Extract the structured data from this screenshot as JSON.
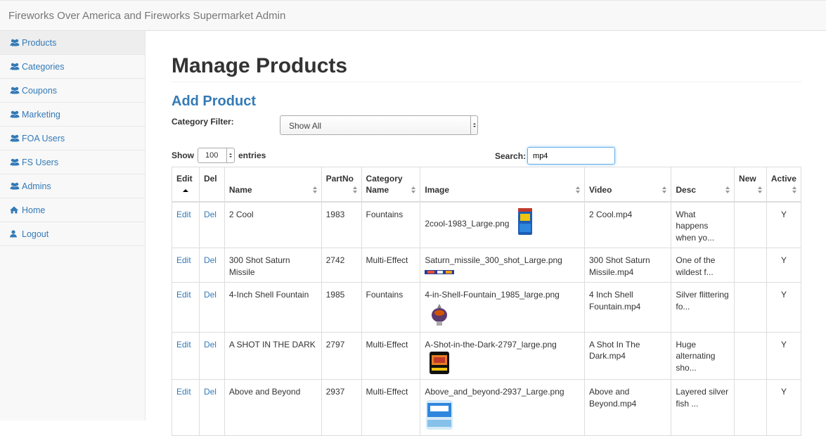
{
  "app": {
    "title": "Fireworks Over America and Fireworks Supermarket Admin"
  },
  "sidebar": {
    "items": [
      {
        "label": "Products",
        "icon": "users-icon",
        "active": true
      },
      {
        "label": "Categories",
        "icon": "users-icon"
      },
      {
        "label": "Coupons",
        "icon": "users-icon"
      },
      {
        "label": "Marketing",
        "icon": "users-icon"
      },
      {
        "label": "FOA Users",
        "icon": "users-icon"
      },
      {
        "label": "FS Users",
        "icon": "users-icon"
      },
      {
        "label": "Admins",
        "icon": "users-icon"
      },
      {
        "label": "Home",
        "icon": "home-icon"
      },
      {
        "label": "Logout",
        "icon": "user-icon"
      }
    ]
  },
  "page": {
    "heading": "Manage Products",
    "add_link": "Add Product",
    "filter_label": "Category Filter:",
    "filter_value": "Show All",
    "show_label": "Show",
    "entries_value": "100",
    "entries_label": "entries",
    "search_label": "Search:",
    "search_value": "mp4"
  },
  "table": {
    "columns": [
      "Edit",
      "Del",
      "Name",
      "PartNo",
      "Category Name",
      "Image",
      "Video",
      "Desc",
      "New",
      "Active"
    ],
    "rows": [
      {
        "edit": "Edit",
        "del": "Del",
        "name": "2 Cool",
        "partno": "1983",
        "category": "Fountains",
        "image": "2cool-1983_Large.png",
        "video": "2 Cool.mp4",
        "desc": "What happens when yo...",
        "new": "",
        "active": "Y"
      },
      {
        "edit": "Edit",
        "del": "Del",
        "name": "300 Shot Saturn Missile",
        "partno": "2742",
        "category": "Multi-Effect",
        "image": "Saturn_missile_300_shot_Large.png",
        "video": "300 Shot Saturn Missile.mp4",
        "desc": "One of the wildest f...",
        "new": "",
        "active": "Y"
      },
      {
        "edit": "Edit",
        "del": "Del",
        "name": "4-Inch Shell Fountain",
        "partno": "1985",
        "category": "Fountains",
        "image": "4-in-Shell-Fountain_1985_large.png",
        "video": "4 Inch Shell Fountain.mp4",
        "desc": "Silver flittering fo...",
        "new": "",
        "active": "Y"
      },
      {
        "edit": "Edit",
        "del": "Del",
        "name": "A SHOT IN THE DARK",
        "partno": "2797",
        "category": "Multi-Effect",
        "image": "A-Shot-in-the-Dark-2797_large.png",
        "video": "A Shot In The Dark.mp4",
        "desc": "Huge alternating sho...",
        "new": "",
        "active": "Y"
      },
      {
        "edit": "Edit",
        "del": "Del",
        "name": "Above and Beyond",
        "partno": "2937",
        "category": "Multi-Effect",
        "image": "Above_and_beyond-2937_Large.png",
        "video": "Above and Beyond.mp4",
        "desc": "Layered silver fish ...",
        "new": "",
        "active": "Y"
      }
    ]
  },
  "colors": {
    "link": "#337ab7",
    "nav_bg": "#f8f8f8",
    "border": "#dddddd"
  }
}
